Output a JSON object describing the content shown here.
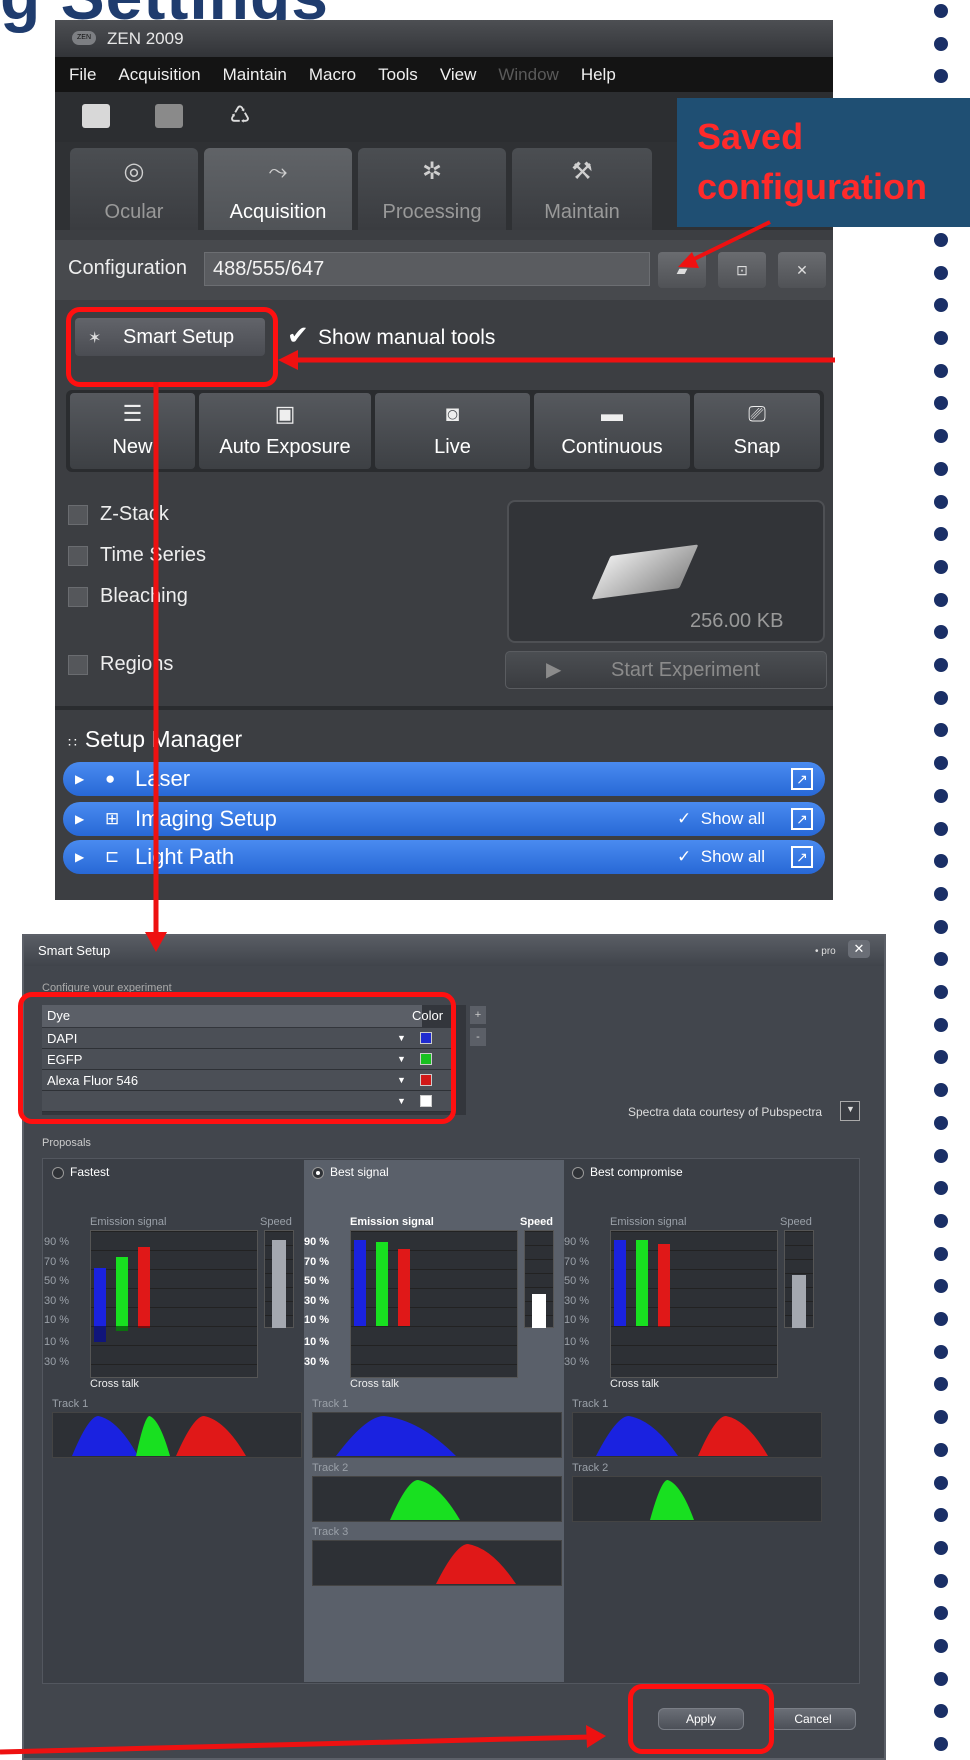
{
  "slide": {
    "title": "g Settings"
  },
  "zen": {
    "window_title": "ZEN 2009",
    "logo": "ZEN",
    "menu": [
      "File",
      "Acquisition",
      "Maintain",
      "Macro",
      "Tools",
      "View",
      "Window",
      "Help"
    ],
    "tabs": [
      "Ocular",
      "Acquisition",
      "Processing",
      "Maintain"
    ],
    "configuration_label": "Configuration",
    "configuration_value": "488/555/647",
    "smart_setup_label": "Smart Setup",
    "show_manual_tools": "Show manual tools",
    "actions": [
      "New",
      "Auto Exposure",
      "Live",
      "Continuous",
      "Snap"
    ],
    "checkboxes": [
      "Z-Stack",
      "Time Series",
      "Bleaching",
      "Regions"
    ],
    "preview_size": "256.00 KB",
    "start_experiment": "Start Experiment",
    "setup_manager": "Setup Manager",
    "setup_items": [
      {
        "label": "Laser",
        "show_all": ""
      },
      {
        "label": "Imaging Setup",
        "show_all": "Show all"
      },
      {
        "label": "Light Path",
        "show_all": "Show all"
      }
    ]
  },
  "callout": {
    "line1": "Saved",
    "line2": "configuration"
  },
  "dialog": {
    "title": "Smart Setup",
    "pro": "• pro",
    "configure": "Configure your experiment",
    "dye_header": "Dye",
    "color_header": "Color",
    "dyes": [
      {
        "name": "DAPI",
        "color": "#1f2bd0"
      },
      {
        "name": "EGFP",
        "color": "#18c020"
      },
      {
        "name": "Alexa Fluor 546",
        "color": "#d01818"
      },
      {
        "name": "",
        "color": "#ffffff"
      }
    ],
    "pubspectra": "Spectra data courtesy of Pubspectra",
    "proposals_label": "Proposals",
    "proposals": [
      {
        "name": "Fastest",
        "selected": false,
        "emission": [
          60,
          72,
          82
        ],
        "speed": 92,
        "crosstalk": [
          40,
          12,
          5
        ],
        "tracks": [
          "Track 1"
        ]
      },
      {
        "name": "Best signal",
        "selected": true,
        "emission": [
          90,
          88,
          80
        ],
        "speed": 35,
        "crosstalk": [
          0,
          0,
          0
        ],
        "tracks": [
          "Track 1",
          "Track 2",
          "Track 3"
        ]
      },
      {
        "name": "Best compromise",
        "selected": false,
        "emission": [
          90,
          90,
          85
        ],
        "speed": 55,
        "crosstalk": [
          0,
          0,
          3
        ],
        "tracks": [
          "Track 1",
          "Track 2"
        ]
      }
    ],
    "emission_label": "Emission signal",
    "speed_label": "Speed",
    "crosstalk_label": "Cross talk",
    "y_ticks_top": [
      "90 %",
      "70 %",
      "50 %",
      "30 %",
      "10 %"
    ],
    "y_ticks_bottom": [
      "10 %",
      "30 %"
    ],
    "apply": "Apply",
    "cancel": "Cancel"
  }
}
